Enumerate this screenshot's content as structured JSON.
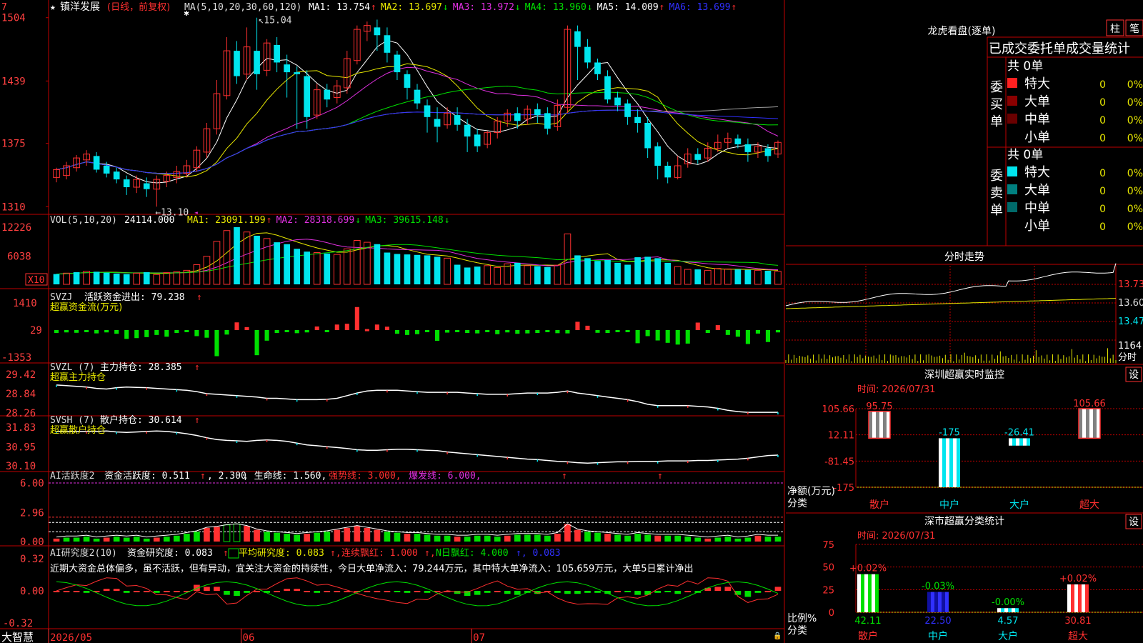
{
  "colors": {
    "up": "#ff3030",
    "down": "#00e5ee",
    "green": "#00e000",
    "frame": "#c00000",
    "white": "#ffffff",
    "yellow": "#e8e800",
    "magenta": "#e030e0",
    "grey": "#a0a0a0",
    "blue": "#3030ff",
    "dark": "#000000"
  },
  "brand": "大智慧",
  "x_dates": [
    "2026/05",
    "06",
    "07"
  ],
  "panels": {
    "kline": {
      "title_star": "★",
      "name": "镇洋发展",
      "mode": "(日线，前复权)",
      "ma_title": "MA(5,10,20,30,60,120)",
      "ma_values": [
        {
          "label": "MA1:",
          "value": "13.754",
          "arrow": "↑",
          "color": "#ffffff"
        },
        {
          "label": "MA2:",
          "value": "13.697",
          "arrow": "↓",
          "color": "#e8e800"
        },
        {
          "label": "MA3:",
          "value": "13.972",
          "arrow": "↓",
          "color": "#e030e0"
        },
        {
          "label": "MA4:",
          "value": "13.960",
          "arrow": "↓",
          "color": "#00e000"
        },
        {
          "label": "MA5:",
          "value": "14.009",
          "arrow": "↑",
          "color": "#ffffff"
        },
        {
          "label": "MA6:",
          "value": "13.699",
          "arrow": "↑",
          "color": "#3030ff"
        }
      ],
      "ticks": [
        "1504",
        "1439",
        "1375",
        "1310"
      ],
      "hi_label": "15.04",
      "lo_label": "←13.10"
    },
    "vol": {
      "title": "VOL(5,10,20)",
      "value": "24114.000",
      "ma": [
        {
          "label": "MA1:",
          "value": "23091.199",
          "arrow": "↑",
          "color": "#e8e800"
        },
        {
          "label": "MA2:",
          "value": "28318.699",
          "arrow": "↓",
          "color": "#e030e0"
        },
        {
          "label": "MA3:",
          "value": "39615.148",
          "arrow": "↓",
          "color": "#00e000"
        }
      ],
      "ticks": [
        "12226",
        "6038"
      ],
      "unit": "X10"
    },
    "svzj": {
      "title": "SVZJ",
      "label": "活跃资金进出:",
      "value": "79.238",
      "sub": "超赢资金流(万元)",
      "ticks": [
        "1410",
        "29",
        "-1353"
      ]
    },
    "svzl": {
      "title": "SVZL (7)",
      "label": "主力持仓:",
      "value": "28.385",
      "sub": "超赢主力持仓",
      "ticks": [
        "29.42",
        "28.84",
        "28.26"
      ]
    },
    "svsh": {
      "title": "SVSH (7)",
      "label": "散户持仓:",
      "value": "30.614",
      "sub": "超赢散户持仓",
      "ticks": [
        "31.83",
        "30.95",
        "30.10"
      ]
    },
    "ai1": {
      "title": "AI活跃度2",
      "label": "资金活跃度:",
      "value": "0.511",
      "v2": "2.300",
      "lifeline_label": "生命线:",
      "lifeline": "1.560",
      "strong": "强势线: 3.000",
      "burst": "爆发线: 6.000",
      "ticks": [
        "6.00",
        "2.96",
        "0.00"
      ]
    },
    "ai2": {
      "title": "AI研究度2(10)",
      "label": "资金研究度:",
      "value": "0.083",
      "avg": "平均研究度: 0.083",
      "red": "连续飘红: 1.000",
      "nred": "N日飘红: 4.000",
      "last": "0.083",
      "comment": "近期大资金总体偏多，虽不活跃，但有异动，宜关注大资金的持续性，今日大单净流入：79.244万元，其中特大单净流入：105.659万元，大单5日累计净出",
      "ticks": [
        "0.32",
        "0.00",
        "-0.32"
      ]
    }
  },
  "right": {
    "lhb_title": "龙虎看盘(逐单)",
    "btn_bar": "柱",
    "btn_pen": "笔",
    "header": "已成交委托单成交量统计",
    "buy_label": "委买单",
    "sell_label": "委卖单",
    "buy_total": "共 0单",
    "sell_total": "共 0单",
    "buy_rows": [
      {
        "name": "特大",
        "count": "0",
        "pct": "0%",
        "color": "#ff2020"
      },
      {
        "name": "大单",
        "count": "0",
        "pct": "0%",
        "color": "#8b0000"
      },
      {
        "name": "中单",
        "count": "0",
        "pct": "0%",
        "color": "#6a0000"
      },
      {
        "name": "小单",
        "count": "0",
        "pct": "0%",
        "color": ""
      }
    ],
    "sell_rows": [
      {
        "name": "特大",
        "count": "0",
        "pct": "0%",
        "color": "#00e5ee"
      },
      {
        "name": "大单",
        "count": "0",
        "pct": "0%",
        "color": "#008080"
      },
      {
        "name": "中单",
        "count": "0",
        "pct": "0%",
        "color": "#006a6a"
      },
      {
        "name": "小单",
        "count": "0",
        "pct": "0%",
        "color": ""
      }
    ],
    "intraday_title": "分时走势",
    "intraday_ticks": [
      "13.73",
      "13.60",
      "13.47"
    ],
    "intraday_vol": "1164",
    "intraday_label": "分时",
    "monitor_title": "深圳超赢实时监控",
    "set_label": "设",
    "time_label": "时间: 2026/07/31",
    "net_label": "净额(万元)",
    "cat_label": "分类",
    "monitor_ticks": [
      "105.66",
      "12.11",
      "-81.45",
      "-175"
    ],
    "stat_title": "深市超赢分类统计",
    "ratio_label": "比例%",
    "stat_ticks": [
      "75",
      "50",
      "25",
      "0"
    ],
    "categories": [
      "散户",
      "中户",
      "大户",
      "超大"
    ]
  },
  "chart_data": [
    {
      "type": "candlestick",
      "title": "镇洋发展 (日线，前复权)",
      "ylim": [
        13.1,
        15.04
      ],
      "ohlc": [
        [
          13.4,
          13.48,
          13.35,
          13.5
        ],
        [
          13.42,
          13.52,
          13.38,
          13.56
        ],
        [
          13.5,
          13.6,
          13.46,
          13.63
        ],
        [
          13.58,
          13.64,
          13.52,
          13.68
        ],
        [
          13.62,
          13.48,
          13.45,
          13.66
        ],
        [
          13.52,
          13.44,
          13.4,
          13.56
        ],
        [
          13.46,
          13.38,
          13.34,
          13.5
        ],
        [
          13.38,
          13.3,
          13.22,
          13.42
        ],
        [
          13.3,
          13.38,
          13.24,
          13.42
        ],
        [
          13.34,
          13.28,
          13.2,
          13.4
        ],
        [
          13.28,
          13.38,
          13.1,
          13.42
        ],
        [
          13.36,
          13.42,
          13.3,
          13.46
        ],
        [
          13.4,
          13.46,
          13.34,
          13.52
        ],
        [
          13.44,
          13.52,
          13.4,
          13.58
        ],
        [
          13.5,
          13.68,
          13.46,
          13.72
        ],
        [
          13.66,
          13.9,
          13.6,
          13.96
        ],
        [
          13.9,
          14.26,
          13.84,
          14.4
        ],
        [
          14.24,
          14.7,
          14.2,
          14.84
        ],
        [
          14.7,
          14.44,
          14.36,
          14.8
        ],
        [
          14.46,
          14.74,
          14.4,
          14.94
        ],
        [
          14.7,
          14.46,
          14.3,
          15.04
        ],
        [
          14.5,
          14.78,
          14.44,
          14.82
        ],
        [
          14.76,
          14.58,
          14.48,
          14.84
        ],
        [
          14.56,
          14.48,
          14.22,
          14.66
        ],
        [
          14.48,
          14.46,
          13.9,
          14.54
        ],
        [
          14.44,
          14.02,
          13.9,
          14.5
        ],
        [
          14.04,
          14.3,
          14.0,
          14.36
        ],
        [
          14.3,
          14.2,
          14.12,
          14.36
        ],
        [
          14.22,
          14.34,
          14.16,
          14.4
        ],
        [
          14.32,
          14.62,
          14.26,
          14.7
        ],
        [
          14.6,
          14.92,
          14.56,
          14.96
        ],
        [
          14.9,
          14.96,
          14.8,
          15.0
        ],
        [
          14.94,
          14.86,
          14.7,
          15.02
        ],
        [
          14.86,
          14.68,
          14.58,
          14.94
        ],
        [
          14.66,
          14.48,
          14.4,
          14.7
        ],
        [
          14.46,
          14.32,
          14.2,
          14.5
        ],
        [
          14.3,
          14.16,
          14.1,
          14.36
        ],
        [
          14.14,
          14.02,
          13.86,
          14.2
        ],
        [
          14.0,
          13.92,
          13.76,
          14.12
        ],
        [
          13.94,
          14.06,
          13.9,
          14.12
        ],
        [
          14.04,
          13.94,
          13.88,
          14.12
        ],
        [
          13.94,
          13.82,
          13.66,
          14.0
        ],
        [
          13.84,
          13.72,
          13.66,
          13.9
        ],
        [
          13.74,
          13.86,
          13.7,
          13.88
        ],
        [
          13.86,
          13.98,
          13.8,
          14.02
        ],
        [
          13.98,
          14.06,
          13.92,
          14.1
        ],
        [
          14.06,
          13.98,
          13.9,
          14.12
        ],
        [
          14.0,
          14.1,
          13.94,
          14.14
        ],
        [
          14.1,
          14.04,
          13.96,
          14.16
        ],
        [
          14.06,
          13.9,
          13.84,
          14.12
        ],
        [
          13.92,
          14.14,
          13.88,
          14.2
        ],
        [
          14.12,
          14.92,
          14.06,
          14.96
        ],
        [
          14.9,
          14.74,
          14.4,
          14.96
        ],
        [
          14.74,
          14.58,
          14.52,
          14.82
        ],
        [
          14.58,
          14.46,
          14.4,
          14.62
        ],
        [
          14.44,
          14.2,
          14.16,
          14.5
        ],
        [
          14.22,
          14.14,
          14.08,
          14.28
        ],
        [
          14.16,
          14.02,
          13.94,
          14.2
        ],
        [
          14.02,
          13.96,
          13.86,
          14.1
        ],
        [
          13.96,
          13.7,
          13.6,
          14.02
        ],
        [
          13.72,
          13.52,
          13.38,
          13.76
        ],
        [
          13.52,
          13.4,
          13.34,
          13.56
        ],
        [
          13.4,
          13.52,
          13.38,
          13.62
        ],
        [
          13.54,
          13.64,
          13.5,
          13.7
        ],
        [
          13.64,
          13.58,
          13.54,
          13.7
        ],
        [
          13.6,
          13.7,
          13.56,
          13.76
        ],
        [
          13.7,
          13.76,
          13.66,
          13.84
        ],
        [
          13.76,
          13.8,
          13.7,
          13.86
        ],
        [
          13.8,
          13.74,
          13.7,
          13.84
        ],
        [
          13.74,
          13.66,
          13.56,
          13.8
        ],
        [
          13.66,
          13.72,
          13.6,
          13.76
        ],
        [
          13.7,
          13.62,
          13.56,
          13.74
        ],
        [
          13.64,
          13.76,
          13.6,
          13.78
        ]
      ],
      "ma_colors": [
        "#ffffff",
        "#e8e800",
        "#e030e0",
        "#00e000",
        "#a0a0a0",
        "#3030ff"
      ]
    },
    {
      "type": "bar",
      "title": "VOL(5,10,20)",
      "ylim": [
        0,
        12226
      ],
      "values": [
        2200,
        2400,
        2600,
        2800,
        2700,
        2500,
        2300,
        2200,
        2400,
        2600,
        2100,
        2500,
        2700,
        3000,
        4200,
        6000,
        9200,
        11500,
        12226,
        11200,
        10400,
        9800,
        9000,
        8600,
        7600,
        7000,
        6800,
        6600,
        6400,
        7600,
        9400,
        9000,
        8600,
        6800,
        6500,
        6400,
        6300,
        6200,
        5900,
        5600,
        4200,
        3600,
        3800,
        4000,
        3600,
        4400,
        4600,
        4000,
        3900,
        3700,
        4100,
        10800,
        6200,
        5600,
        5000,
        5200,
        4600,
        4200,
        5800,
        5900,
        5600,
        4600,
        3800,
        3200,
        3200,
        3000,
        3400,
        3300,
        3200,
        3100,
        3000,
        2900,
        2800
      ],
      "up": [
        false,
        true,
        false,
        true,
        false,
        false,
        false,
        false,
        true,
        false,
        true,
        true,
        true,
        true,
        true,
        true,
        true,
        true,
        false,
        true,
        false,
        true,
        false,
        false,
        false,
        false,
        true,
        false,
        true,
        true,
        true,
        true,
        false,
        false,
        false,
        false,
        false,
        false,
        false,
        true,
        false,
        false,
        false,
        true,
        true,
        true,
        false,
        true,
        false,
        false,
        true,
        true,
        false,
        false,
        false,
        false,
        false,
        false,
        false,
        false,
        false,
        false,
        true,
        true,
        false,
        true,
        true,
        true,
        false,
        false,
        true,
        false,
        true
      ]
    },
    {
      "type": "bar",
      "title": "超赢资金流(万元)",
      "ylim": [
        -1353,
        1410
      ],
      "values": [
        -120,
        -90,
        -110,
        -80,
        -140,
        -90,
        -160,
        -420,
        -380,
        -330,
        -220,
        -310,
        -120,
        -80,
        -280,
        -360,
        -1300,
        -200,
        420,
        180,
        -1250,
        -510,
        -120,
        -70,
        -130,
        -90,
        210,
        -70,
        310,
        350,
        1200,
        80,
        310,
        200,
        -160,
        -220,
        -180,
        -80,
        -520,
        -100,
        -80,
        -120,
        -140,
        -70,
        -180,
        -90,
        -160,
        -140,
        -120,
        -80,
        -130,
        -140,
        450,
        250,
        -110,
        -120,
        -80,
        -80,
        -640,
        -280,
        -500,
        -620,
        -710,
        -660,
        410,
        -120,
        280,
        -220,
        -310,
        -680,
        -150,
        -580,
        -90
      ],
      "note": "ticks 1410 / 29 / -1353"
    },
    {
      "type": "line",
      "title": "超赢主力持仓",
      "ylim": [
        28.26,
        29.42
      ],
      "values": [
        29.1,
        29.08,
        29.06,
        29.04,
        29.0,
        28.98,
        29.02,
        29.04,
        29.03,
        29.02,
        29.0,
        28.98,
        28.96,
        28.94,
        28.9,
        28.84,
        28.82,
        28.8,
        28.78,
        28.76,
        28.74,
        28.7,
        28.7,
        28.68,
        28.66,
        28.66,
        28.66,
        28.67,
        28.7,
        28.78,
        28.86,
        28.92,
        28.94,
        28.94,
        28.94,
        28.92,
        28.9,
        28.88,
        28.88,
        28.88,
        28.88,
        28.86,
        28.84,
        28.82,
        28.82,
        28.82,
        28.84,
        28.86,
        28.86,
        28.86,
        28.88,
        28.92,
        28.86,
        28.82,
        28.78,
        28.74,
        28.7,
        28.66,
        28.6,
        28.52,
        28.48,
        28.48,
        28.48,
        28.48,
        28.46,
        28.44,
        28.4,
        28.34,
        28.3,
        28.28,
        28.28,
        28.28,
        28.28
      ]
    },
    {
      "type": "line",
      "title": "超赢散户持仓",
      "ylim": [
        30.1,
        31.83
      ],
      "values": [
        31.64,
        31.64,
        31.64,
        31.64,
        31.64,
        31.66,
        31.62,
        31.6,
        31.62,
        31.64,
        31.66,
        31.64,
        31.6,
        31.54,
        31.46,
        31.36,
        31.28,
        31.24,
        31.22,
        31.2,
        31.24,
        31.26,
        31.24,
        31.2,
        31.12,
        31.04,
        31.0,
        30.96,
        30.92,
        30.88,
        30.82,
        30.8,
        30.8,
        30.82,
        30.84,
        30.84,
        30.82,
        30.8,
        30.78,
        30.72,
        30.68,
        30.64,
        30.6,
        30.56,
        30.52,
        30.48,
        30.44,
        30.4,
        30.38,
        30.34,
        30.3,
        30.28,
        30.24,
        30.22,
        30.24,
        30.26,
        30.28,
        30.28,
        30.3,
        30.3,
        30.3,
        30.32,
        30.32,
        30.32,
        30.34,
        30.34,
        30.36,
        30.38,
        30.4,
        30.44,
        30.5,
        30.56,
        30.58
      ]
    },
    {
      "type": "bar",
      "title": "AI活跃度2",
      "ylim": [
        0,
        6.0
      ],
      "values": [
        0.3,
        0.4,
        0.4,
        0.5,
        0.3,
        0.4,
        0.5,
        0.4,
        0.5,
        0.3,
        0.4,
        0.5,
        0.6,
        0.8,
        1.0,
        1.4,
        1.5,
        1.7,
        1.8,
        1.6,
        1.2,
        1.0,
        0.9,
        0.8,
        0.7,
        0.8,
        0.9,
        1.0,
        1.2,
        1.4,
        1.6,
        1.4,
        1.2,
        1.0,
        0.9,
        0.8,
        0.8,
        0.7,
        0.6,
        0.6,
        0.5,
        0.5,
        0.6,
        0.6,
        0.5,
        0.6,
        0.7,
        0.7,
        0.7,
        0.6,
        0.8,
        1.8,
        1.2,
        1.0,
        0.9,
        0.8,
        0.7,
        0.6,
        0.8,
        0.7,
        0.6,
        0.6,
        0.6,
        0.5,
        0.4,
        0.3,
        0.4,
        0.5,
        0.3,
        0.4,
        0.6,
        0.5,
        0.5
      ]
    },
    {
      "type": "bar",
      "title": "AI研究度2(10)",
      "ylim": [
        -0.32,
        0.32
      ],
      "values": [
        0.0,
        0.0,
        0.0,
        -0.02,
        0.0,
        0.02,
        0.02,
        -0.02,
        0.0,
        0.0,
        -0.02,
        0.0,
        0.0,
        0.0,
        0.06,
        0.04,
        0.04,
        -0.04,
        -0.05,
        -0.02,
        0.0,
        -0.02,
        0.0,
        0.02,
        0.02,
        0.0,
        -0.02,
        0.0,
        0.0,
        0.0,
        0.0,
        0.0,
        0.0,
        0.0,
        -0.01,
        -0.02,
        0.0,
        -0.02,
        0.0,
        0.0,
        -0.03,
        -0.05,
        -0.04,
        -0.02,
        0.0,
        -0.03,
        -0.04,
        -0.02,
        -0.03,
        0.0,
        -0.02,
        -0.03,
        -0.03,
        -0.02,
        -0.02,
        -0.03,
        0.0,
        -0.01,
        -0.04,
        -0.04,
        -0.02,
        -0.01,
        -0.03,
        0.0,
        -0.02,
        0.03,
        0.04,
        0.04,
        -0.04,
        -0.06,
        -0.02,
        0.0,
        0.04
      ]
    }
  ]
}
